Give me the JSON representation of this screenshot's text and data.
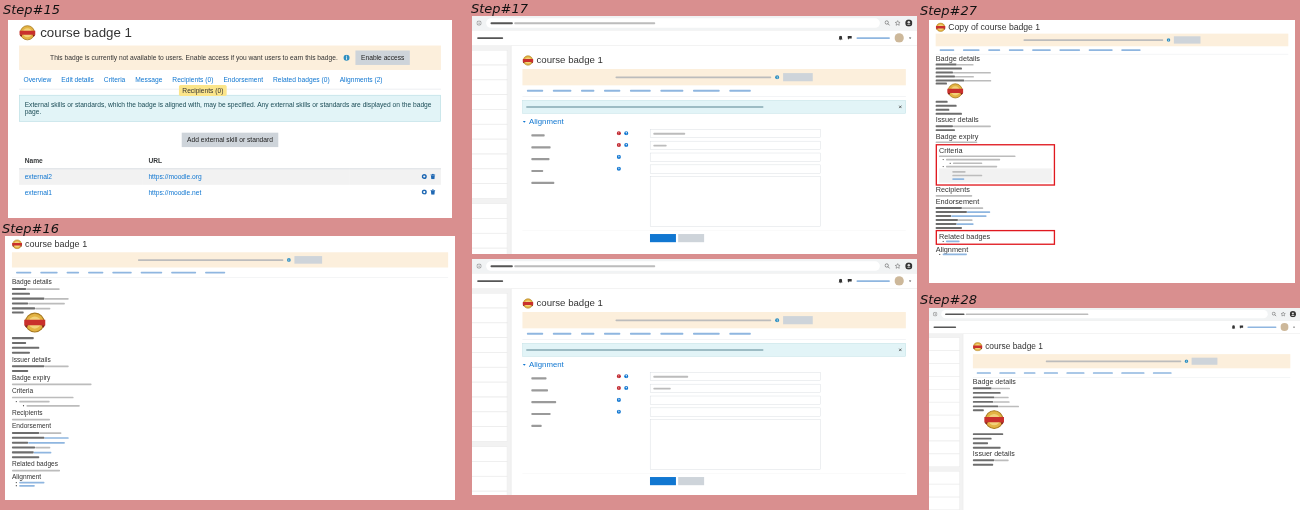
{
  "panels": [
    {
      "step": "Step#15",
      "browser": false,
      "sidebar": false,
      "title": "course badge 1",
      "notice": {
        "text": "This badge is currently not available to users. Enable access if you want users to earn this badge.",
        "button": "Enable access"
      },
      "tabs": [
        {
          "label": "Overview"
        },
        {
          "label": "Edit details"
        },
        {
          "label": "Criteria"
        },
        {
          "label": "Message"
        },
        {
          "label": "Recipients (0)",
          "tooltip": "Recipients (0)"
        },
        {
          "label": "Endorsement"
        },
        {
          "label": "Related badges (0)"
        },
        {
          "label": "Alignments (2)"
        }
      ],
      "alert": {
        "text": "External skills or standards, which the badge is aligned with, may be specified. Any external skills or standards are displayed on the badge page.",
        "closable": false
      },
      "blocks": [
        {
          "kind": "center-button",
          "label": "Add external skill or standard"
        },
        {
          "kind": "table",
          "columns": [
            "Name",
            "URL"
          ],
          "rows": [
            {
              "cells": [
                "external2",
                "https://moodle.org"
              ],
              "actions": true
            },
            {
              "cells": [
                "external1",
                "https://moodle.net"
              ],
              "actions": true
            }
          ]
        }
      ]
    },
    {
      "step": "Step#16",
      "browser": false,
      "sidebar": false,
      "title": "course badge 1",
      "notice": {
        "kind": "blurred"
      },
      "tabs": {
        "kind": "blurred"
      },
      "blocks": [
        {
          "kind": "heading",
          "text": "Badge details"
        },
        {
          "kind": "row",
          "has_value": true,
          "link": false
        },
        {
          "kind": "row",
          "has_value": false
        },
        {
          "kind": "row",
          "has_value": true,
          "link": false
        },
        {
          "kind": "row",
          "has_value": true,
          "link": false
        },
        {
          "kind": "row",
          "has_value": true,
          "link": false
        },
        {
          "kind": "image-row"
        },
        {
          "kind": "row",
          "has_value": false
        },
        {
          "kind": "row",
          "has_value": false
        },
        {
          "kind": "row",
          "has_value": false
        },
        {
          "kind": "row",
          "has_value": false
        },
        {
          "kind": "heading",
          "text": "Issuer details"
        },
        {
          "kind": "row",
          "has_value": true,
          "link": false
        },
        {
          "kind": "row",
          "has_value": false
        },
        {
          "kind": "heading",
          "text": "Badge expiry"
        },
        {
          "kind": "text-line"
        },
        {
          "kind": "heading",
          "text": "Criteria"
        },
        {
          "kind": "text-line"
        },
        {
          "kind": "bullets",
          "items": [
            {
              "link": false,
              "children": [
                {
                  "link": false
                }
              ]
            }
          ]
        },
        {
          "kind": "heading",
          "text": "Recipients"
        },
        {
          "kind": "text-line"
        },
        {
          "kind": "heading",
          "text": "Endorsement"
        },
        {
          "kind": "row",
          "has_value": true,
          "link": false
        },
        {
          "kind": "row",
          "has_value": true,
          "link": true
        },
        {
          "kind": "row",
          "has_value": true,
          "link": true
        },
        {
          "kind": "row",
          "has_value": true,
          "link": false
        },
        {
          "kind": "row",
          "has_value": true,
          "link": true
        },
        {
          "kind": "row",
          "has_value": false
        },
        {
          "kind": "heading",
          "text": "Related badges"
        },
        {
          "kind": "text-line"
        },
        {
          "kind": "heading",
          "text": "Alignment"
        },
        {
          "kind": "bullets",
          "items": [
            {
              "link": true
            },
            {
              "link": true
            }
          ]
        }
      ]
    },
    {
      "step": "Step#17",
      "browser": true,
      "sidebar": true,
      "title": "course badge 1",
      "notice": {
        "kind": "blurred"
      },
      "tabs": {
        "kind": "blurred"
      },
      "alert": {
        "closable": true
      },
      "blocks": [
        {
          "kind": "section-toggle",
          "text": "Alignment",
          "expanded": true
        },
        {
          "kind": "form-field",
          "required": true,
          "help": true,
          "filled": true,
          "multiline": false
        },
        {
          "kind": "form-field",
          "required": true,
          "help": true,
          "filled": true,
          "multiline": false
        },
        {
          "kind": "form-field",
          "required": false,
          "help": true,
          "filled": false,
          "multiline": false
        },
        {
          "kind": "form-field",
          "required": false,
          "help": true,
          "filled": false,
          "multiline": false
        },
        {
          "kind": "form-field",
          "required": false,
          "help": false,
          "filled": false,
          "multiline": true
        },
        {
          "kind": "buttons",
          "items": [
            {
              "primary": true
            },
            {
              "primary": false
            }
          ]
        }
      ]
    },
    {
      "browser": true,
      "sidebar": true,
      "title": "course badge 1",
      "notice": {
        "kind": "blurred"
      },
      "tabs": {
        "kind": "blurred"
      },
      "alert": {
        "closable": true
      },
      "blocks": [
        {
          "kind": "section-toggle",
          "text": "Alignment",
          "expanded": true
        },
        {
          "kind": "form-field",
          "required": true,
          "help": true,
          "filled": true,
          "multiline": false
        },
        {
          "kind": "form-field",
          "required": true,
          "help": true,
          "filled": true,
          "multiline": false
        },
        {
          "kind": "form-field",
          "required": false,
          "help": true,
          "filled": false,
          "multiline": false
        },
        {
          "kind": "form-field",
          "required": false,
          "help": true,
          "filled": false,
          "multiline": false
        },
        {
          "kind": "form-field",
          "required": false,
          "help": false,
          "filled": false,
          "multiline": true
        },
        {
          "kind": "buttons",
          "items": [
            {
              "primary": true
            },
            {
              "primary": false
            }
          ]
        }
      ]
    },
    {
      "step": "Step#27",
      "browser": false,
      "sidebar": false,
      "title": "Copy of course badge 1",
      "notice": {
        "kind": "blurred"
      },
      "tabs": {
        "kind": "blurred"
      },
      "blocks": [
        {
          "kind": "heading",
          "text": "Badge details"
        },
        {
          "kind": "row",
          "has_value": true,
          "link": false
        },
        {
          "kind": "row",
          "has_value": false
        },
        {
          "kind": "row",
          "has_value": true,
          "link": false
        },
        {
          "kind": "row",
          "has_value": true,
          "link": false
        },
        {
          "kind": "row",
          "has_value": true,
          "link": false
        },
        {
          "kind": "image-row"
        },
        {
          "kind": "row",
          "has_value": false
        },
        {
          "kind": "row",
          "has_value": false
        },
        {
          "kind": "row",
          "has_value": false
        },
        {
          "kind": "row",
          "has_value": false
        },
        {
          "kind": "heading",
          "text": "Issuer details"
        },
        {
          "kind": "row",
          "has_value": true,
          "link": false
        },
        {
          "kind": "row",
          "has_value": false
        },
        {
          "kind": "heading",
          "text": "Badge expiry"
        },
        {
          "kind": "text-line"
        },
        {
          "kind": "highlight",
          "blocks": [
            {
              "kind": "heading",
              "text": "Criteria"
            },
            {
              "kind": "text-line"
            },
            {
              "kind": "bullets",
              "items": [
                {
                  "link": false,
                  "children": [
                    {
                      "link": false
                    }
                  ]
                },
                {
                  "link": false
                }
              ]
            },
            {
              "kind": "criteria-box"
            }
          ]
        },
        {
          "kind": "heading",
          "text": "Recipients"
        },
        {
          "kind": "text-line"
        },
        {
          "kind": "heading",
          "text": "Endorsement"
        },
        {
          "kind": "row",
          "has_value": true,
          "link": false
        },
        {
          "kind": "row",
          "has_value": true,
          "link": true
        },
        {
          "kind": "row",
          "has_value": true,
          "link": true
        },
        {
          "kind": "row",
          "has_value": true,
          "link": false
        },
        {
          "kind": "row",
          "has_value": true,
          "link": true
        },
        {
          "kind": "row",
          "has_value": false
        },
        {
          "kind": "highlight",
          "blocks": [
            {
              "kind": "heading",
              "text": "Related badges"
            },
            {
              "kind": "bullets",
              "items": [
                {
                  "link": true
                }
              ]
            }
          ]
        },
        {
          "kind": "heading",
          "text": "Alignment"
        },
        {
          "kind": "bullets",
          "items": [
            {
              "link": true
            }
          ]
        }
      ]
    },
    {
      "step": "Step#28",
      "browser": true,
      "sidebar": true,
      "title": "course badge 1",
      "notice": {
        "kind": "blurred"
      },
      "tabs": {
        "kind": "blurred"
      },
      "blocks": [
        {
          "kind": "heading",
          "text": "Badge details"
        },
        {
          "kind": "row",
          "has_value": true,
          "link": false
        },
        {
          "kind": "row",
          "has_value": false
        },
        {
          "kind": "row",
          "has_value": true,
          "link": false
        },
        {
          "kind": "row",
          "has_value": true,
          "link": false
        },
        {
          "kind": "row",
          "has_value": true,
          "link": false
        },
        {
          "kind": "image-row"
        },
        {
          "kind": "row",
          "has_value": false
        },
        {
          "kind": "row",
          "has_value": false
        },
        {
          "kind": "row",
          "has_value": false
        },
        {
          "kind": "row",
          "has_value": false
        },
        {
          "kind": "heading",
          "text": "Issuer details"
        },
        {
          "kind": "row",
          "has_value": true,
          "link": false
        },
        {
          "kind": "row",
          "has_value": false
        }
      ]
    }
  ]
}
